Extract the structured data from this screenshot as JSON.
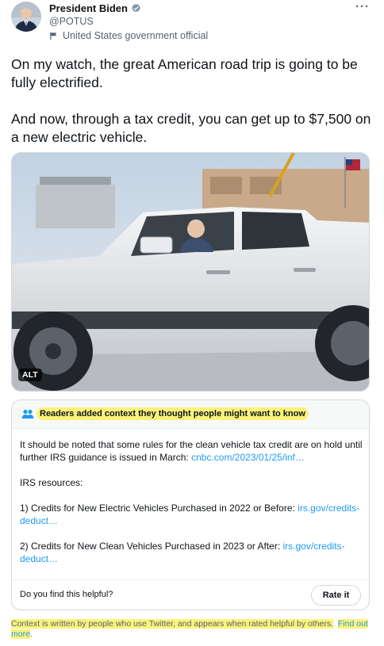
{
  "author": {
    "name": "President Biden",
    "handle": "@POTUS",
    "label": "United States government official",
    "verified": true
  },
  "menu": {
    "more": "···"
  },
  "tweet": {
    "paragraph1": "On my watch, the great American road trip is going to be fully electrified.",
    "paragraph2": "And now, through a tax credit, you can get up to $7,500 on a new electric vehicle."
  },
  "media": {
    "alt_badge": "ALT"
  },
  "community_notes": {
    "title": "Readers added context they thought people might want to know",
    "note_text": "It should be noted that some rules for the clean vehicle tax credit are on hold until further IRS guidance is issued in March: ",
    "note_link": "cnbc.com/2023/01/25/inf…",
    "resources_label": "IRS resources:",
    "item1_text": "1) Credits for New Electric Vehicles Purchased in 2022 or Before: ",
    "item1_link": "irs.gov/credits-deduct…",
    "item2_text": "2) Credits for New Clean Vehicles Purchased in 2023 or After: ",
    "item2_link": "irs.gov/credits-deduct…",
    "helpful_question": "Do you find this helpful?",
    "rate_button": "Rate it"
  },
  "footer": {
    "text": "Context is written by people who use Twitter, and appears when rated helpful by others.",
    "link": "Find out more",
    "end": "."
  },
  "colors": {
    "link": "#1d9bf0",
    "highlight": "#fbf27a",
    "secondary_text": "#536471"
  }
}
